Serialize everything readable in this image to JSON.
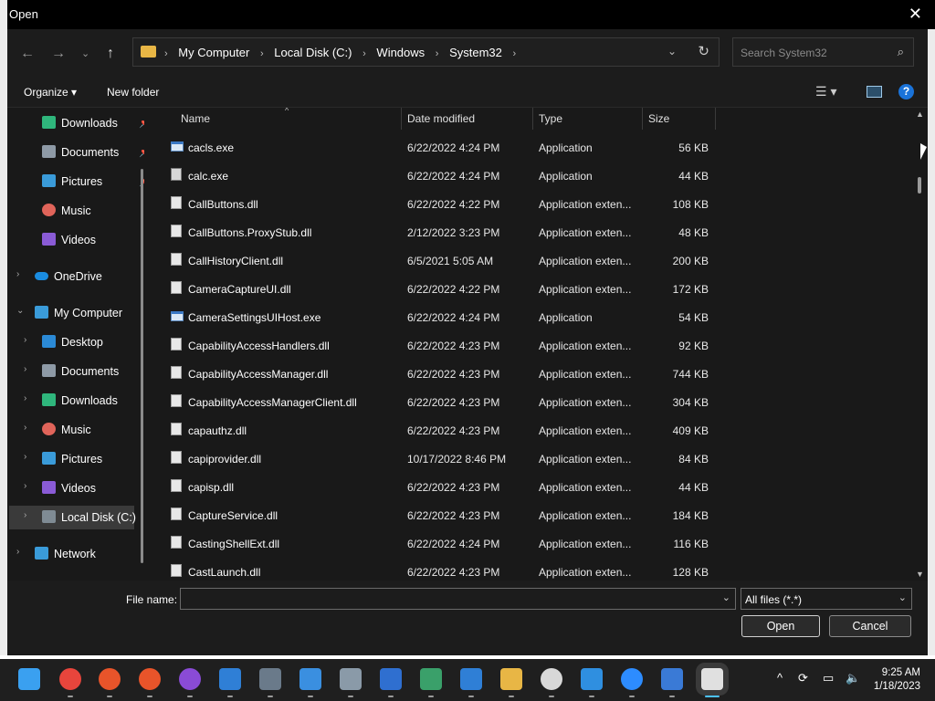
{
  "dialog": {
    "title": "Open"
  },
  "nav": {
    "back_icon": "arrow-left-icon",
    "forward_icon": "arrow-right-icon",
    "recent_icon": "chevron-down-icon",
    "up_icon": "arrow-up-icon",
    "breadcrumbs": [
      "My Computer",
      "Local Disk (C:)",
      "Windows",
      "System32"
    ],
    "search_placeholder": "Search System32"
  },
  "toolbar": {
    "organize": "Organize ▾",
    "new_folder": "New folder",
    "help": "?"
  },
  "sidebar": {
    "quick": [
      {
        "label": "Downloads",
        "icon": "download-icon",
        "color": "#2fb67c",
        "pinned": "📌"
      },
      {
        "label": "Documents",
        "icon": "document-icon",
        "color": "#8e9aa6",
        "pinned": "📌"
      },
      {
        "label": "Pictures",
        "icon": "picture-icon",
        "color": "#3a9bd9",
        "pinned": "📌"
      },
      {
        "label": "Music",
        "icon": "music-icon",
        "color": "#e0645a",
        "pinned": ""
      },
      {
        "label": "Videos",
        "icon": "video-icon",
        "color": "#8a5bd6",
        "pinned": ""
      }
    ],
    "onedrive": {
      "label": "OneDrive",
      "icon": "cloud-icon",
      "color": "#1a8ce0"
    },
    "computer": {
      "label": "My Computer",
      "icon": "computer-icon",
      "color": "#3a9bd9"
    },
    "computer_children": [
      {
        "label": "Desktop",
        "icon": "desktop-icon",
        "color": "#2b8ad6"
      },
      {
        "label": "Documents",
        "icon": "document-icon",
        "color": "#8e9aa6"
      },
      {
        "label": "Downloads",
        "icon": "download-icon",
        "color": "#2fb67c"
      },
      {
        "label": "Music",
        "icon": "music-icon",
        "color": "#e0645a"
      },
      {
        "label": "Pictures",
        "icon": "picture-icon",
        "color": "#3a9bd9"
      },
      {
        "label": "Videos",
        "icon": "video-icon",
        "color": "#8a5bd6"
      },
      {
        "label": "Local Disk (C:)",
        "icon": "drive-icon",
        "color": "#7f8b94"
      }
    ],
    "network": {
      "label": "Network",
      "icon": "network-icon",
      "color": "#3a9bd9"
    }
  },
  "columns": {
    "name": "Name",
    "date": "Date modified",
    "type": "Type",
    "size": "Size"
  },
  "files": [
    {
      "name": "cacls.exe",
      "date": "6/22/2022 4:24 PM",
      "type": "Application",
      "size": "56 KB",
      "kind": "exe"
    },
    {
      "name": "calc.exe",
      "date": "6/22/2022 4:24 PM",
      "type": "Application",
      "size": "44 KB",
      "kind": "calc"
    },
    {
      "name": "CallButtons.dll",
      "date": "6/22/2022 4:22 PM",
      "type": "Application exten...",
      "size": "108 KB",
      "kind": "dll"
    },
    {
      "name": "CallButtons.ProxyStub.dll",
      "date": "2/12/2022 3:23 PM",
      "type": "Application exten...",
      "size": "48 KB",
      "kind": "dll"
    },
    {
      "name": "CallHistoryClient.dll",
      "date": "6/5/2021 5:05 AM",
      "type": "Application exten...",
      "size": "200 KB",
      "kind": "dll"
    },
    {
      "name": "CameraCaptureUI.dll",
      "date": "6/22/2022 4:22 PM",
      "type": "Application exten...",
      "size": "172 KB",
      "kind": "dll"
    },
    {
      "name": "CameraSettingsUIHost.exe",
      "date": "6/22/2022 4:24 PM",
      "type": "Application",
      "size": "54 KB",
      "kind": "exe"
    },
    {
      "name": "CapabilityAccessHandlers.dll",
      "date": "6/22/2022 4:23 PM",
      "type": "Application exten...",
      "size": "92 KB",
      "kind": "dll"
    },
    {
      "name": "CapabilityAccessManager.dll",
      "date": "6/22/2022 4:23 PM",
      "type": "Application exten...",
      "size": "744 KB",
      "kind": "dll"
    },
    {
      "name": "CapabilityAccessManagerClient.dll",
      "date": "6/22/2022 4:23 PM",
      "type": "Application exten...",
      "size": "304 KB",
      "kind": "dll"
    },
    {
      "name": "capauthz.dll",
      "date": "6/22/2022 4:23 PM",
      "type": "Application exten...",
      "size": "409 KB",
      "kind": "dll"
    },
    {
      "name": "capiprovider.dll",
      "date": "10/17/2022 8:46 PM",
      "type": "Application exten...",
      "size": "84 KB",
      "kind": "dll"
    },
    {
      "name": "capisp.dll",
      "date": "6/22/2022 4:23 PM",
      "type": "Application exten...",
      "size": "44 KB",
      "kind": "dll"
    },
    {
      "name": "CaptureService.dll",
      "date": "6/22/2022 4:23 PM",
      "type": "Application exten...",
      "size": "184 KB",
      "kind": "dll"
    },
    {
      "name": "CastingShellExt.dll",
      "date": "6/22/2022 4:24 PM",
      "type": "Application exten...",
      "size": "116 KB",
      "kind": "dll"
    },
    {
      "name": "CastLaunch.dll",
      "date": "6/22/2022 4:23 PM",
      "type": "Application exten...",
      "size": "128 KB",
      "kind": "dll"
    }
  ],
  "bottom": {
    "file_name_label": "File name:",
    "file_name_value": "",
    "file_type": "All files (*.*)",
    "open": "Open",
    "cancel": "Cancel"
  },
  "taskbar": {
    "apps": [
      {
        "name": "start-icon",
        "color": "#3aa0f0"
      },
      {
        "name": "chrome-icon",
        "color": "#e8453c"
      },
      {
        "name": "app-x-icon",
        "color": "#e8542a"
      },
      {
        "name": "app-x-icon",
        "color": "#e8542a"
      },
      {
        "name": "github-icon",
        "color": "#8a4bd6"
      },
      {
        "name": "mail-icon",
        "color": "#2f7fd6"
      },
      {
        "name": "calculator-icon",
        "color": "#6a7a8a"
      },
      {
        "name": "notepad-icon",
        "color": "#3a8fe0"
      },
      {
        "name": "settings-icon",
        "color": "#8a9aa8"
      },
      {
        "name": "media-player-icon",
        "color": "#2f6fd0"
      },
      {
        "name": "maps-icon",
        "color": "#3aa06a"
      },
      {
        "name": "calendar-icon",
        "color": "#2f7fd6"
      },
      {
        "name": "file-explorer-icon",
        "color": "#e8b645"
      },
      {
        "name": "clock-app-icon",
        "color": "#d8d8d8"
      },
      {
        "name": "vscode-icon",
        "color": "#2f8fe0"
      },
      {
        "name": "zoom-icon",
        "color": "#2d8cff"
      },
      {
        "name": "app-blue-icon",
        "color": "#3a7ad6"
      },
      {
        "name": "active-app-icon",
        "color": "#e0e0e0"
      }
    ],
    "time": "9:25 AM",
    "date": "1/18/2023"
  }
}
